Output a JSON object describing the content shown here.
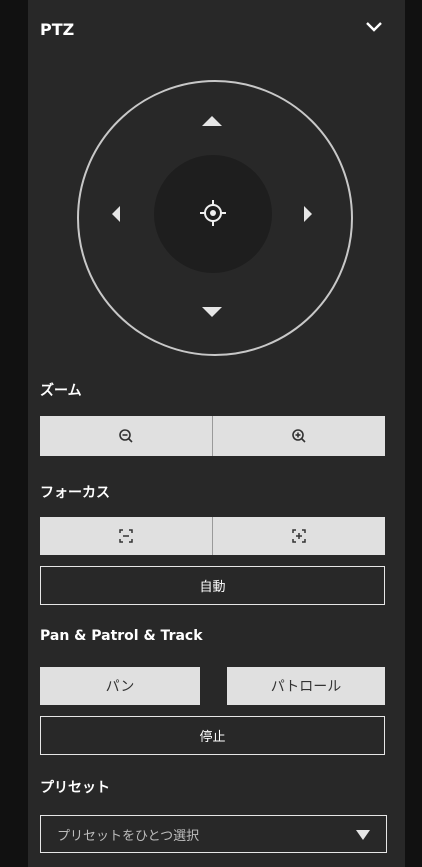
{
  "panel": {
    "title": "PTZ",
    "collapse_icon": "chevron-down-icon"
  },
  "ptz_control": {
    "up_icon": "arrow-up-icon",
    "down_icon": "arrow-down-icon",
    "left_icon": "arrow-left-icon",
    "right_icon": "arrow-right-icon",
    "center_icon": "crosshair-icon"
  },
  "zoom": {
    "title": "ズーム",
    "zoom_out_icon": "zoom-out-icon",
    "zoom_in_icon": "zoom-in-icon"
  },
  "focus": {
    "title": "フォーカス",
    "focus_near_icon": "focus-near-icon",
    "focus_far_icon": "focus-far-icon",
    "auto_label": "自動"
  },
  "pan_patrol": {
    "title": "Pan & Patrol & Track",
    "pan_label": "パン",
    "patrol_label": "パトロール",
    "stop_label": "停止"
  },
  "preset": {
    "title": "プリセット",
    "placeholder": "プリセットをひとつ選択",
    "dropdown_icon": "caret-down-icon"
  },
  "colors": {
    "panel_bg": "#282828",
    "page_bg": "#111111",
    "button_light": "#e0e0e0",
    "border": "#e6e6e6"
  }
}
